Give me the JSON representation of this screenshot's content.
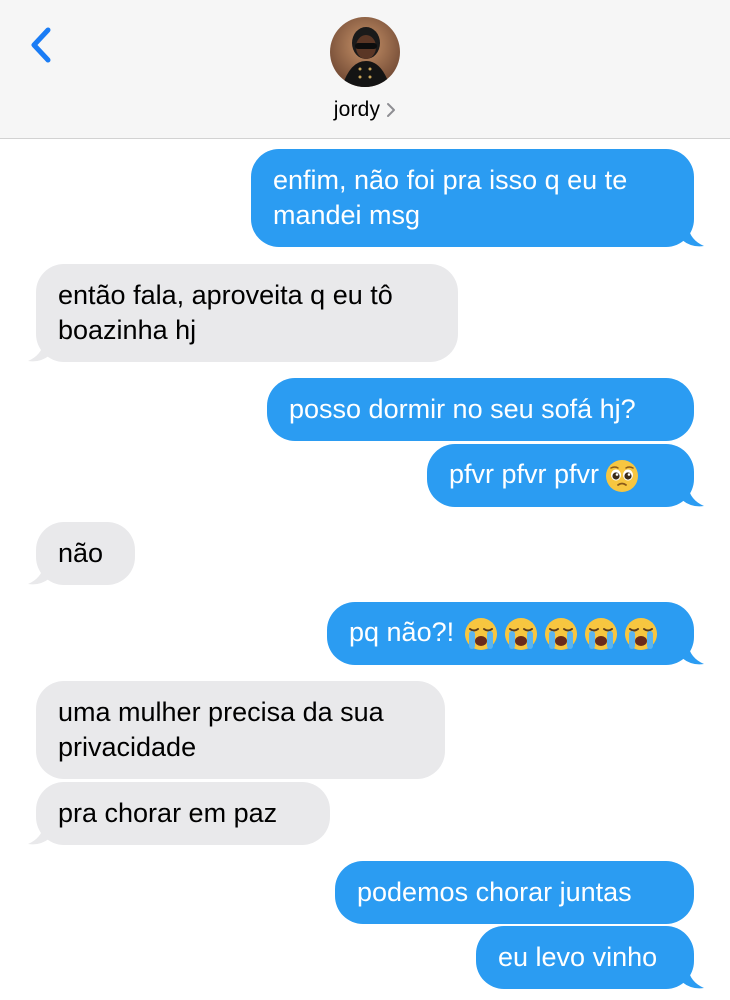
{
  "header": {
    "contact_name": "jordy"
  },
  "messages": [
    {
      "side": "sent",
      "lines": [
        "enfim, não foi pra isso q eu te",
        "mandei msg"
      ]
    },
    {
      "side": "recv",
      "lines": [
        "então fala, aproveita q eu tô",
        "boazinha hj"
      ]
    },
    {
      "side": "sent",
      "lines": [
        "posso dormir no seu sofá hj?"
      ]
    },
    {
      "side": "sent",
      "text": "pfvr pfvr pfvr",
      "emoji": "pleading-face"
    },
    {
      "side": "recv",
      "lines": [
        "não"
      ]
    },
    {
      "side": "sent",
      "text": "pq não?!",
      "emoji": "loudly-crying-face",
      "emoji_count": 5
    },
    {
      "side": "recv",
      "lines": [
        "uma mulher precisa da sua",
        "privacidade"
      ]
    },
    {
      "side": "recv",
      "lines": [
        "pra chorar em paz"
      ]
    },
    {
      "side": "sent",
      "lines": [
        "podemos chorar juntas"
      ]
    },
    {
      "side": "sent",
      "lines": [
        "eu levo vinho"
      ]
    }
  ],
  "colors": {
    "sent_bubble": "#2b9cf2",
    "received_bubble": "#e9e9eb",
    "accent": "#1a7cf5"
  }
}
